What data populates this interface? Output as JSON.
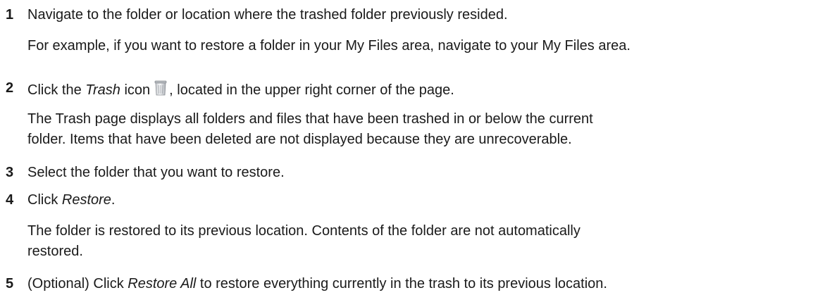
{
  "steps": [
    {
      "number": "1",
      "text": "Navigate to the folder or location where the trashed folder previously resided.",
      "detail": "For example, if you want to restore a folder in your My Files area, navigate to your My Files area."
    },
    {
      "number": "2",
      "text_before": "Click the ",
      "emphasis": "Trash",
      "text_mid": " icon",
      "text_after": ", located in the upper right corner of the page.",
      "icon": "trash-icon",
      "detail_line1": "The Trash page displays all folders and files that have been trashed in or below the current",
      "detail_line2": "folder. Items that have been deleted are not displayed because they are unrecoverable."
    },
    {
      "number": "3",
      "text": "Select the folder that you want to restore."
    },
    {
      "number": "4",
      "text_before": "Click ",
      "emphasis": "Restore",
      "text_after": ".",
      "detail_line1": "The folder is restored to its previous location. Contents of the folder are not automatically",
      "detail_line2": "restored."
    },
    {
      "number": "5",
      "text_before": "(Optional) Click ",
      "emphasis": "Restore All",
      "text_after": " to restore everything currently in the trash to its previous location."
    }
  ]
}
